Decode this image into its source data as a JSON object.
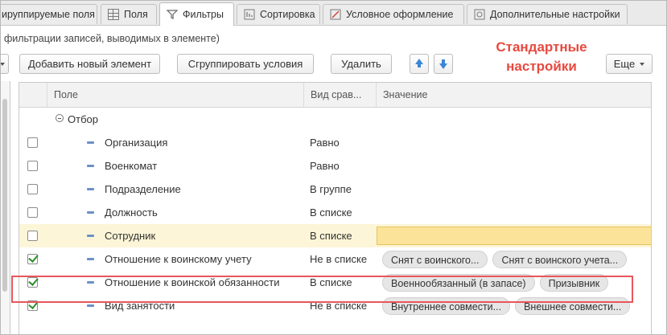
{
  "tabs": [
    {
      "label": "ируппируемые поля",
      "icon": "grid-icon"
    },
    {
      "label": "Поля",
      "icon": "grid-icon"
    },
    {
      "label": "Фильтры",
      "icon": "funnel-icon",
      "active": true
    },
    {
      "label": "Сортировка",
      "icon": "sort-icon"
    },
    {
      "label": "Условное оформление",
      "icon": "format-icon"
    },
    {
      "label": "Дополнительные настройки",
      "icon": "gear-icon"
    }
  ],
  "subtitle": "фильтрации записей, выводимых в элементе)",
  "toolbar": {
    "add": "Добавить новый элемент",
    "group": "Сгруппировать условия",
    "delete": "Удалить",
    "more": "Еще"
  },
  "annotation": "Стандартные настройки",
  "columns": {
    "field": "Поле",
    "comparison": "Вид срав...",
    "value": "Значение"
  },
  "group_row": "Отбор",
  "rows": [
    {
      "name": "Организация",
      "comparison": "Равно",
      "checked": false,
      "values": []
    },
    {
      "name": "Военкомат",
      "comparison": "Равно",
      "checked": false,
      "values": []
    },
    {
      "name": "Подразделение",
      "comparison": "В группе",
      "checked": false,
      "values": []
    },
    {
      "name": "Должность",
      "comparison": "В списке",
      "checked": false,
      "values": []
    },
    {
      "name": "Сотрудник",
      "comparison": "В списке",
      "checked": false,
      "values": [],
      "selected": true
    },
    {
      "name": "Отношение к воинскому учету",
      "comparison": "Не в списке",
      "checked": true,
      "values": [
        "Снят с воинского...",
        "Снят с воинского учета..."
      ]
    },
    {
      "name": "Отношение к воинской обязанности",
      "comparison": "В списке",
      "checked": true,
      "values": [
        "Военнообязанный (в запасе)",
        "Призывник"
      ]
    },
    {
      "name": "Вид занятости",
      "comparison": "Не в списке",
      "checked": true,
      "values": [
        "Внутреннее совмести...",
        "Внешнее совмести..."
      ]
    }
  ],
  "colors": {
    "accent_red": "#e8493f",
    "selected_row": "#fcf5d7",
    "check_green": "#2c8f2c"
  }
}
